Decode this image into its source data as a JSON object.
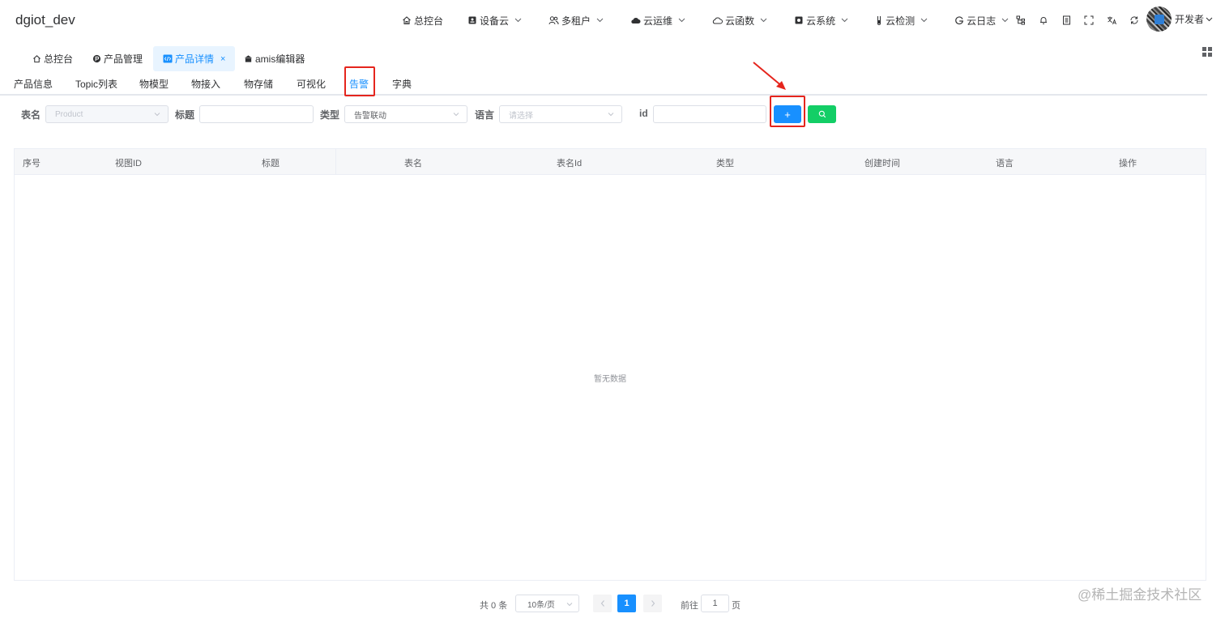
{
  "app": {
    "brand": "dgiot_dev"
  },
  "nav": {
    "menus": [
      {
        "label": "总控台",
        "icon": "home-icon",
        "has_caret": false
      },
      {
        "label": "设备云",
        "icon": "device-icon",
        "has_caret": true
      },
      {
        "label": "多租户",
        "icon": "users-icon",
        "has_caret": true
      },
      {
        "label": "云运维",
        "icon": "cloud-icon",
        "has_caret": true
      },
      {
        "label": "云函数",
        "icon": "cloud-outline-icon",
        "has_caret": true
      },
      {
        "label": "云系统",
        "icon": "system-icon",
        "has_caret": true
      },
      {
        "label": "云检测",
        "icon": "test-tube-icon",
        "has_caret": true
      },
      {
        "label": "云日志",
        "icon": "google-icon",
        "has_caret": true
      }
    ],
    "tools": [
      "tree-icon",
      "bell-icon",
      "document-icon",
      "fullscreen-icon",
      "translate-icon",
      "refresh-icon"
    ],
    "user": {
      "name": "开发者"
    }
  },
  "tags": [
    {
      "label": "总控台",
      "icon": "home-icon",
      "active": false
    },
    {
      "label": "产品管理",
      "icon": "product-icon",
      "active": false
    },
    {
      "label": "产品详情",
      "icon": "code-icon",
      "active": true
    },
    {
      "label": "amis编辑器",
      "icon": "bank-icon",
      "active": false
    }
  ],
  "subtabs": [
    "产品信息",
    "Topic列表",
    "物模型",
    "物接入",
    "物存储",
    "可视化",
    "告警",
    "字典"
  ],
  "active_subtab": "告警",
  "filters": {
    "table_label": "表名",
    "table_value": "Product",
    "title_label": "标题",
    "title_value": "",
    "type_label": "类型",
    "type_value": "告警联动",
    "lang_label": "语言",
    "lang_placeholder": "请选择",
    "id_label": "id",
    "id_value": "",
    "add_label": "+",
    "search_icon": "search-icon"
  },
  "table": {
    "columns": [
      "序号",
      "视图ID",
      "标题",
      "表名",
      "表名Id",
      "类型",
      "创建时间",
      "语言",
      "操作"
    ],
    "rows": [],
    "empty_text": "暂无数据"
  },
  "pagination": {
    "total_text": "共 0 条",
    "page_size": "10条/页",
    "current_page": "1",
    "goto_label": "前往",
    "goto_value": "1",
    "page_suffix": "页"
  },
  "watermark": "@稀土掘金技术社区",
  "colors": {
    "primary": "#1890ff",
    "success": "#13ce66",
    "highlight": "#e5251d"
  }
}
